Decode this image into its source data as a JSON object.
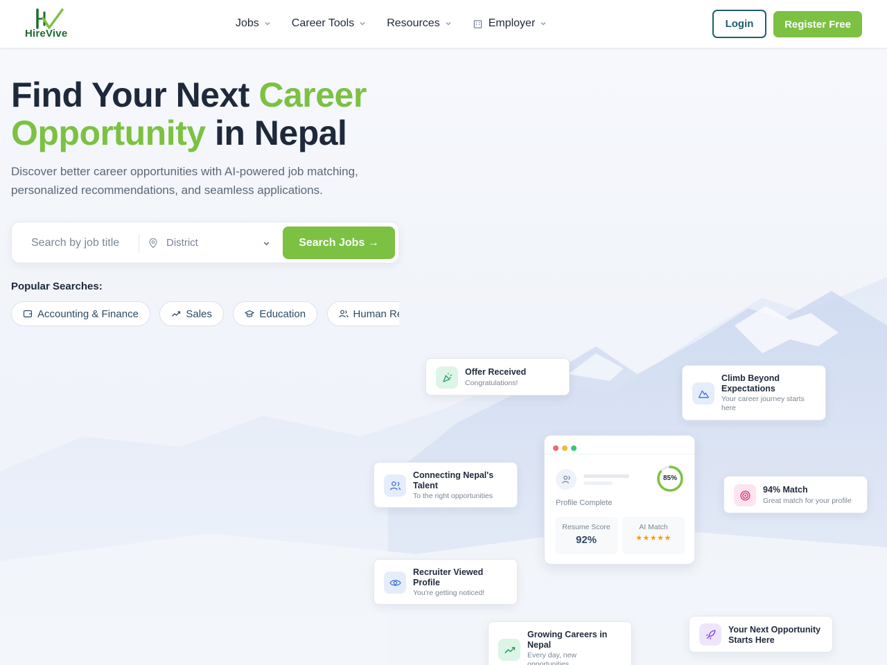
{
  "brand": {
    "name_part1": "Hire",
    "name_part2": "Vive",
    "accent": "#7cc142",
    "dark": "#1f5c6e"
  },
  "nav": {
    "items": [
      {
        "label": "Jobs"
      },
      {
        "label": "Career Tools"
      },
      {
        "label": "Resources"
      },
      {
        "label": "Employer"
      }
    ],
    "login": "Login",
    "register": "Register Free"
  },
  "hero": {
    "title_part1": "Find Your Next ",
    "title_green1": "Career",
    "title_green2": "Opportunity",
    "title_part2": " in Nepal",
    "subtitle": "Discover better career opportunities with AI-powered job matching, personalized recommendations, and seamless applications."
  },
  "search": {
    "placeholder": "Search by job title",
    "district_placeholder": "District",
    "button": "Search Jobs →"
  },
  "popular": {
    "label": "Popular Searches:",
    "chips": [
      {
        "label": "Accounting & Finance",
        "icon": "wallet-icon"
      },
      {
        "label": "Sales",
        "icon": "trending-up-icon"
      },
      {
        "label": "Education",
        "icon": "graduation-cap-icon"
      },
      {
        "label": "Human Resources",
        "icon": "users-icon"
      }
    ]
  },
  "cards": {
    "offer": {
      "title": "Offer Received",
      "sub": "Congratulations!"
    },
    "climb": {
      "title": "Climb Beyond Expectations",
      "sub": "Your career journey starts here"
    },
    "connect": {
      "title": "Connecting Nepal's Talent",
      "sub": "To the right opportunities"
    },
    "match": {
      "title": "94% Match",
      "sub": "Great match for your profile"
    },
    "recruiter": {
      "title": "Recruiter Viewed Profile",
      "sub": "You're getting noticed!"
    },
    "growing": {
      "title": "Growing Careers in Nepal",
      "sub": "Every day, new opportunities"
    },
    "next": {
      "title": "Your Next Opportunity Starts Here",
      "sub": ""
    }
  },
  "profile_card": {
    "progress_label": "85%",
    "progress_value": 0.85,
    "complete_label": "Profile Complete",
    "resume_label": "Resume Score",
    "resume_value": "92%",
    "ai_label": "AI Match",
    "ai_stars": "★★★★★",
    "dot_colors": [
      "#ef6b6b",
      "#f5b83d",
      "#3cc47c"
    ]
  }
}
